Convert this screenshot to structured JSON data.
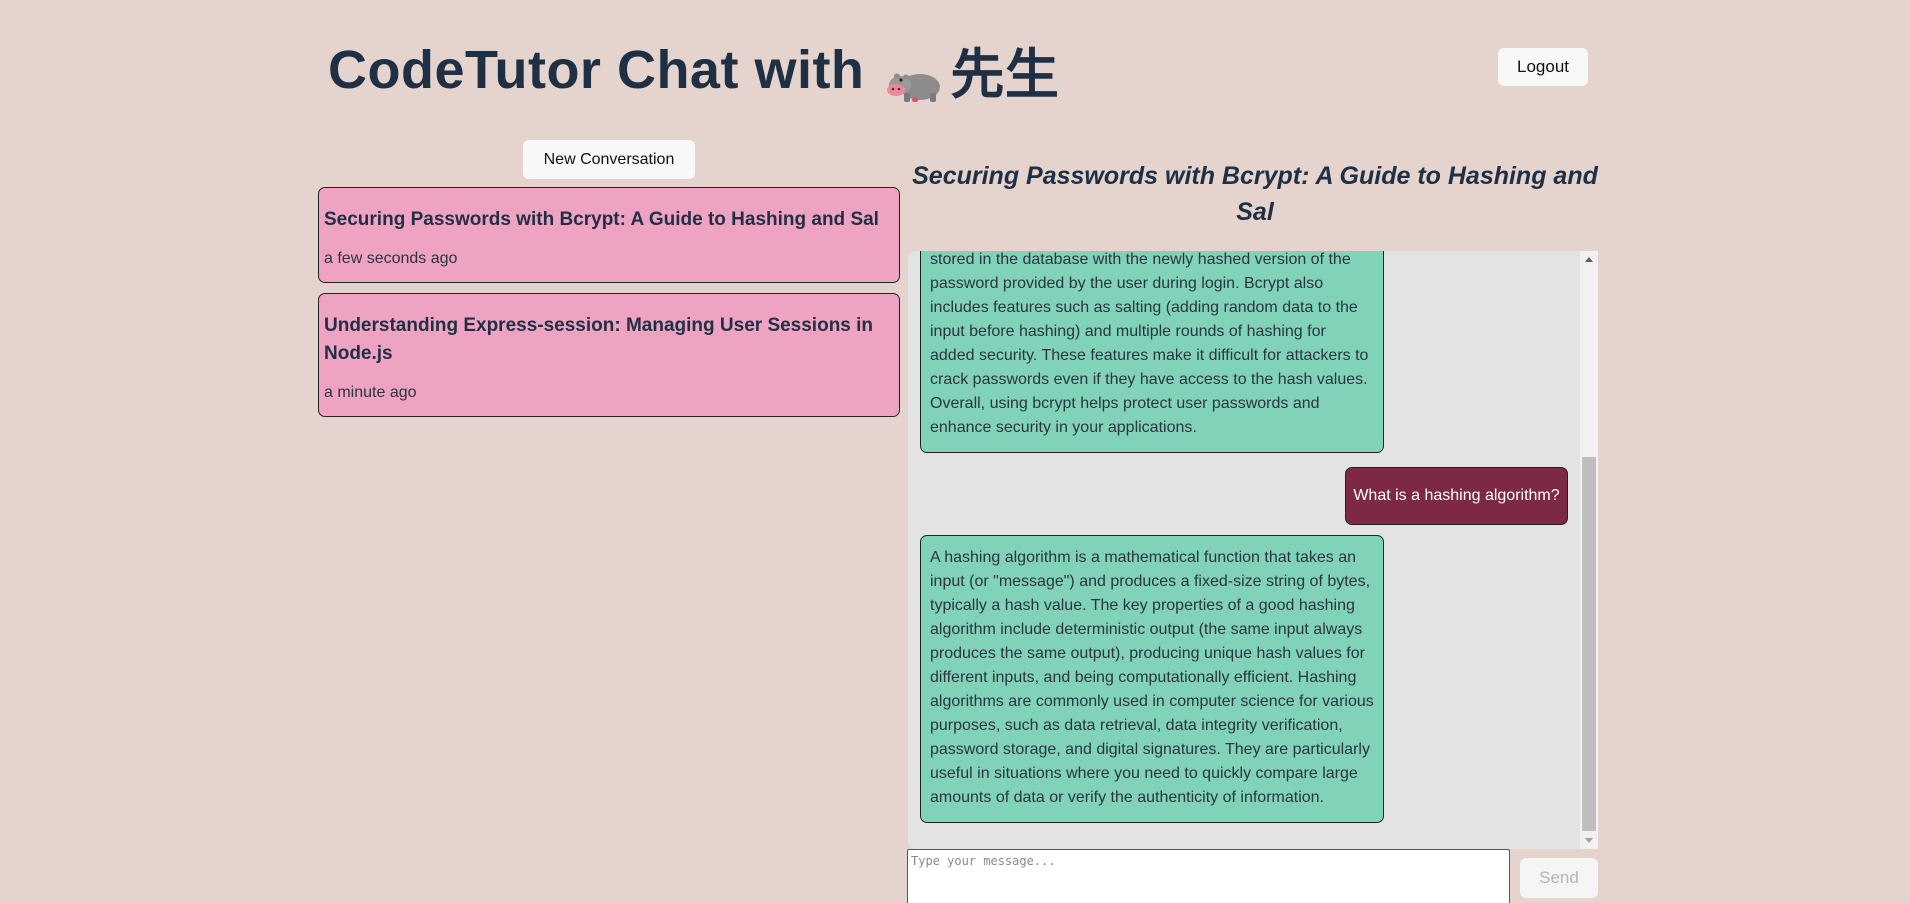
{
  "header": {
    "title": "CodeTutor Chat with ",
    "title_suffix": "先生",
    "mascot_icon": "hippo-icon",
    "logout_label": "Logout"
  },
  "sidebar": {
    "new_conversation_label": "New Conversation",
    "conversations": [
      {
        "title": "Securing Passwords with Bcrypt: A Guide to Hashing and Sal",
        "time": "a few seconds ago"
      },
      {
        "title": "Understanding Express-session: Managing User Sessions in Node.js",
        "time": "a minute ago"
      }
    ]
  },
  "chat": {
    "title": "Securing Passwords with Bcrypt: A Guide to Hashing and Sal",
    "messages": [
      {
        "role": "assistant",
        "text": "stored in the database with the newly hashed version of the password provided by the user during login. Bcrypt also includes features such as salting (adding random data to the input before hashing) and multiple rounds of hashing for added security. These features make it difficult for attackers to crack passwords even if they have access to the hash values. Overall, using bcrypt helps protect user passwords and enhance security in your applications."
      },
      {
        "role": "user",
        "text": "What is a hashing algorithm?"
      },
      {
        "role": "assistant",
        "text": "A hashing algorithm is a mathematical function that takes an input (or \"message\") and produces a fixed-size string of bytes, typically a hash value. The key properties of a good hashing algorithm include deterministic output (the same input always produces the same output), producing unique hash values for different inputs, and being computationally efficient. Hashing algorithms are commonly used in computer science for various purposes, such as data retrieval, data integrity verification, password storage, and digital signatures. They are particularly useful in situations where you need to quickly compare large amounts of data or verify the authenticity of information."
      }
    ],
    "input_placeholder": "Type your message...",
    "input_value": "",
    "send_label": "Send"
  },
  "colors": {
    "background": "#e5d4ce",
    "heading": "#1f2f44",
    "conversation_card": "#efa3c2",
    "assistant_bubble": "#80d3b8",
    "user_bubble": "#7d2943",
    "chat_panel": "#e3e3e3"
  }
}
